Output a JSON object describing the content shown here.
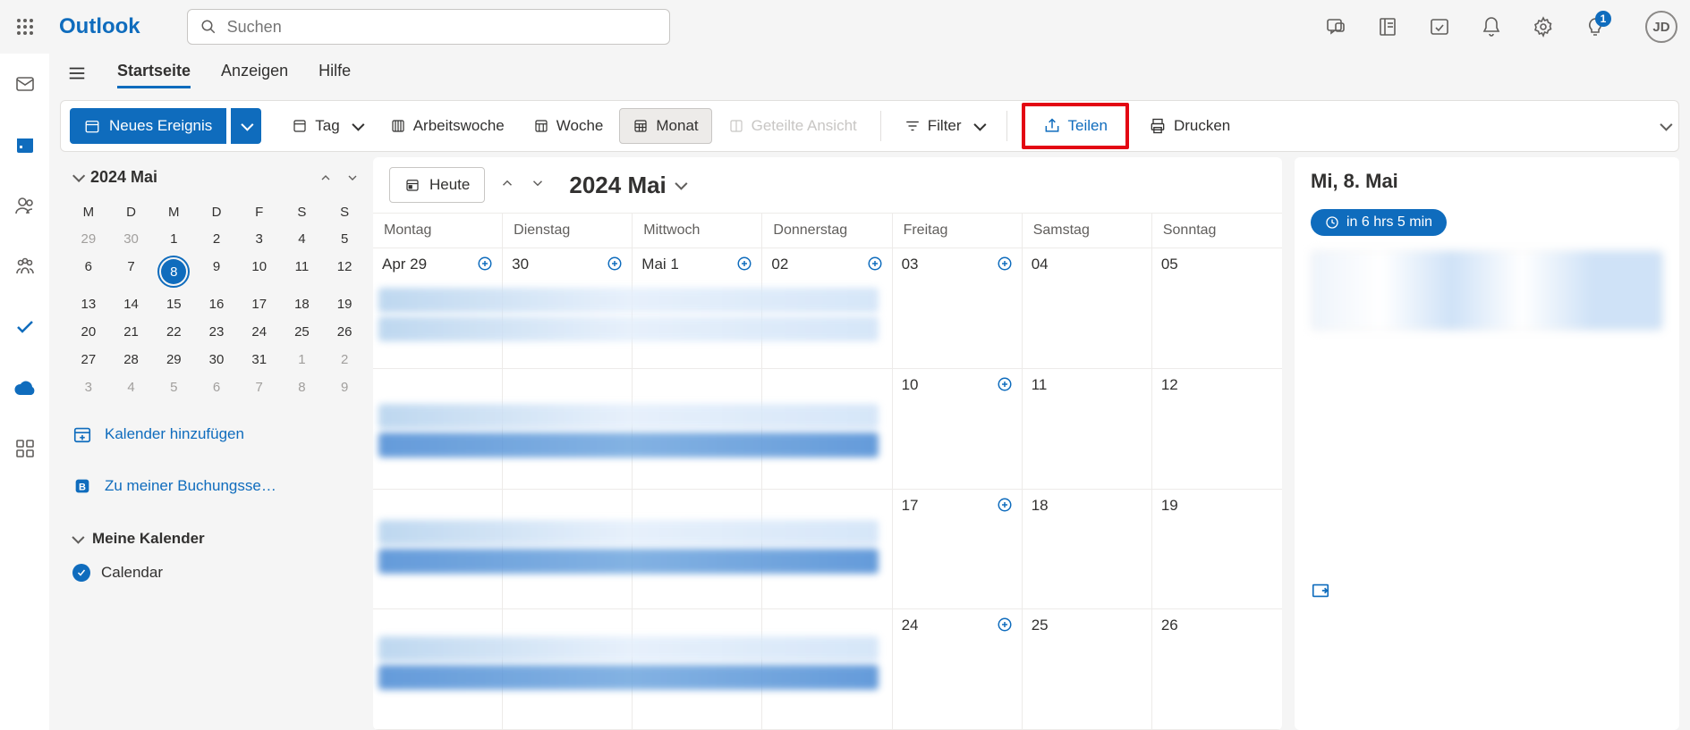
{
  "header": {
    "brand": "Outlook",
    "search_placeholder": "Suchen",
    "notification_badge": "1",
    "avatar_initials": "JD"
  },
  "tabs": {
    "startseite": "Startseite",
    "anzeigen": "Anzeigen",
    "hilfe": "Hilfe"
  },
  "toolbar": {
    "new_event": "Neues Ereignis",
    "day": "Tag",
    "workweek": "Arbeitswoche",
    "week": "Woche",
    "month": "Monat",
    "split_view": "Geteilte Ansicht",
    "filter": "Filter",
    "share": "Teilen",
    "print": "Drucken"
  },
  "mini": {
    "title": "2024 Mai",
    "dow": [
      "M",
      "D",
      "M",
      "D",
      "F",
      "S",
      "S"
    ],
    "weeks": [
      [
        {
          "n": "29",
          "m": true
        },
        {
          "n": "30",
          "m": true
        },
        {
          "n": "1"
        },
        {
          "n": "2"
        },
        {
          "n": "3"
        },
        {
          "n": "4"
        },
        {
          "n": "5"
        }
      ],
      [
        {
          "n": "6"
        },
        {
          "n": "7"
        },
        {
          "n": "8",
          "today": true
        },
        {
          "n": "9"
        },
        {
          "n": "10"
        },
        {
          "n": "11"
        },
        {
          "n": "12"
        }
      ],
      [
        {
          "n": "13"
        },
        {
          "n": "14"
        },
        {
          "n": "15"
        },
        {
          "n": "16"
        },
        {
          "n": "17"
        },
        {
          "n": "18"
        },
        {
          "n": "19"
        }
      ],
      [
        {
          "n": "20"
        },
        {
          "n": "21"
        },
        {
          "n": "22"
        },
        {
          "n": "23"
        },
        {
          "n": "24"
        },
        {
          "n": "25"
        },
        {
          "n": "26"
        }
      ],
      [
        {
          "n": "27"
        },
        {
          "n": "28"
        },
        {
          "n": "29"
        },
        {
          "n": "30"
        },
        {
          "n": "31"
        },
        {
          "n": "1",
          "m": true
        },
        {
          "n": "2",
          "m": true
        }
      ],
      [
        {
          "n": "3",
          "m": true
        },
        {
          "n": "4",
          "m": true
        },
        {
          "n": "5",
          "m": true
        },
        {
          "n": "6",
          "m": true
        },
        {
          "n": "7",
          "m": true
        },
        {
          "n": "8",
          "m": true
        },
        {
          "n": "9",
          "m": true
        }
      ]
    ]
  },
  "sidebar": {
    "add_calendar": "Kalender hinzufügen",
    "booking_page": "Zu meiner Buchungsse…",
    "my_calendars": "Meine Kalender",
    "calendar_name": "Calendar"
  },
  "calendar": {
    "today_btn": "Heute",
    "title": "2024 Mai",
    "dow": [
      "Montag",
      "Dienstag",
      "Mittwoch",
      "Donnerstag",
      "Freitag",
      "Samstag",
      "Sonntag"
    ],
    "rows": [
      [
        {
          "l": "Apr 29",
          "add": true
        },
        {
          "l": "30",
          "add": true
        },
        {
          "l": "Mai 1",
          "add": true
        },
        {
          "l": "02",
          "add": true
        },
        {
          "l": "03",
          "add": true
        },
        {
          "l": "04"
        },
        {
          "l": "05"
        }
      ],
      [
        {
          "l": ""
        },
        {
          "l": ""
        },
        {
          "l": ""
        },
        {
          "l": ""
        },
        {
          "l": "10",
          "add": true
        },
        {
          "l": "11"
        },
        {
          "l": "12"
        }
      ],
      [
        {
          "l": ""
        },
        {
          "l": ""
        },
        {
          "l": ""
        },
        {
          "l": ""
        },
        {
          "l": "17",
          "add": true
        },
        {
          "l": "18"
        },
        {
          "l": "19"
        }
      ],
      [
        {
          "l": ""
        },
        {
          "l": ""
        },
        {
          "l": ""
        },
        {
          "l": ""
        },
        {
          "l": "24",
          "add": true
        },
        {
          "l": "25"
        },
        {
          "l": "26"
        }
      ]
    ]
  },
  "day_panel": {
    "title": "Mi, 8. Mai",
    "chip": "in 6 hrs 5 min"
  }
}
